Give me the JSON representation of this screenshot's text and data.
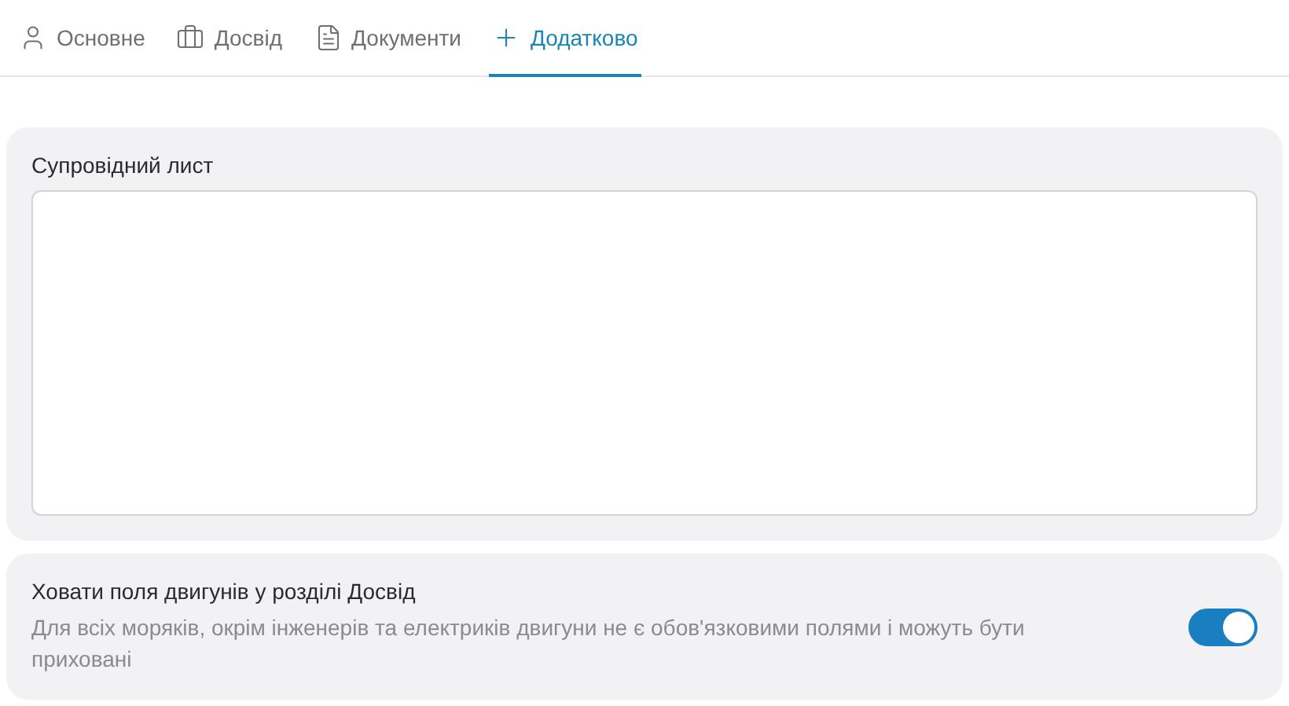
{
  "tabs": [
    {
      "label": "Основне",
      "selected": false
    },
    {
      "label": "Досвід",
      "selected": false
    },
    {
      "label": "Документи",
      "selected": false
    },
    {
      "label": "Додатково",
      "selected": true
    }
  ],
  "cover_letter": {
    "label": "Супровідний лист"
  },
  "setting": {
    "title": "Ховати поля двигунів у розділі Досвід",
    "description": "Для всіх моряків, окрім інженерів та електриків двигуни не є обов'язковими полями і можуть бути приховані",
    "on": true
  }
}
